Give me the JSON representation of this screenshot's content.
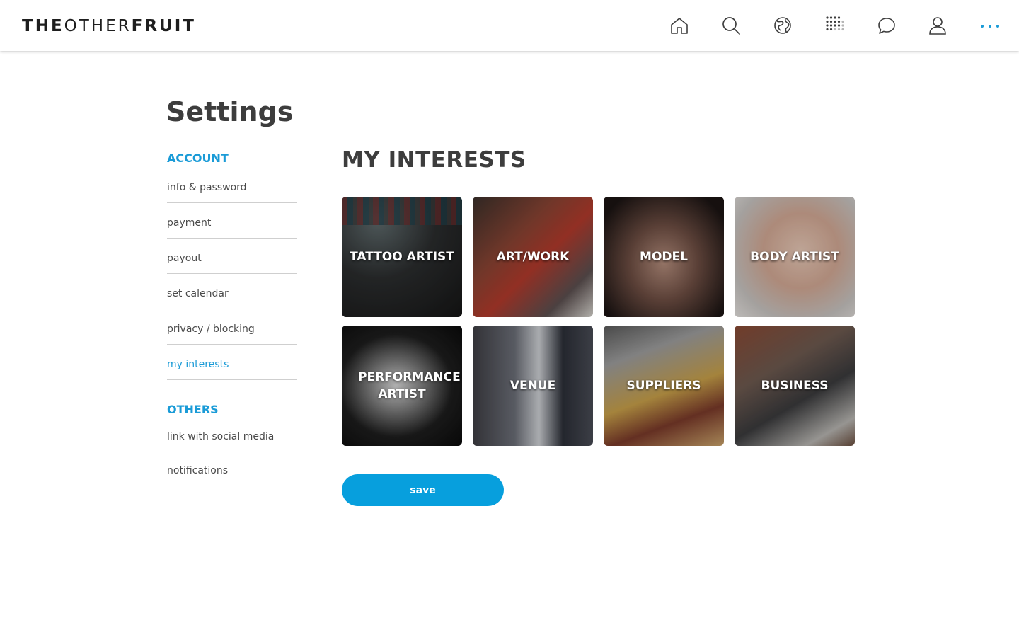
{
  "header": {
    "logo_part1": "THE",
    "logo_part2": "OTHER",
    "logo_part3": "FRUIT",
    "nav": [
      {
        "icon": "home-icon"
      },
      {
        "icon": "search-icon"
      },
      {
        "icon": "globe-icon"
      },
      {
        "icon": "grid-dots-icon"
      },
      {
        "icon": "chat-icon"
      },
      {
        "icon": "user-icon"
      },
      {
        "icon": "more-icon"
      }
    ],
    "accent_color": "#1a9bd7"
  },
  "page_title": "Settings",
  "sidebar": {
    "account_title": "ACCOUNT",
    "account_items": [
      {
        "label": "info & password"
      },
      {
        "label": "payment"
      },
      {
        "label": "payout"
      },
      {
        "label": "set calendar"
      },
      {
        "label": "privacy / blocking"
      },
      {
        "label": "my interests",
        "active": true
      }
    ],
    "others_title": "OTHERS",
    "others_items": [
      {
        "label": "link with social media"
      },
      {
        "label": "notifications"
      }
    ]
  },
  "main": {
    "heading": "MY INTERESTS",
    "interests": [
      {
        "label": "TATTOO ARTIST"
      },
      {
        "label": "ART/WORK"
      },
      {
        "label": "MODEL"
      },
      {
        "label": "BODY ARTIST"
      },
      {
        "label": "PERFORMANCE ARTIST"
      },
      {
        "label": "VENUE"
      },
      {
        "label": "SUPPLIERS"
      },
      {
        "label": "BUSINESS"
      }
    ],
    "save_label": "save",
    "button_color": "#079fdd"
  }
}
